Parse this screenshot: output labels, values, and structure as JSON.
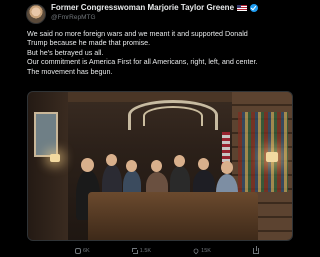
{
  "author": {
    "display_name": "Former Congresswoman Marjorie Taylor Greene",
    "handle": "@FmrRepMTG"
  },
  "icons": {
    "flag": "us-flag-icon",
    "verified": "verified-badge-icon",
    "reply": "reply-icon",
    "retweet": "retweet-icon",
    "like": "heart-icon",
    "share": "share-icon"
  },
  "tweet": {
    "lines": [
      "We said no more foreign wars and we meant it and supported Donald",
      "Trump because he made that promise.",
      "But he's betrayed us all.",
      "Our commitment is America First for all Americans, right, left, and center.",
      "The movement has begun."
    ]
  },
  "stats": {
    "replies": "6K",
    "retweets": "1.5K",
    "likes": "15K",
    "share": ""
  },
  "colors": {
    "background": "#000000",
    "text": "#e7e9ea",
    "secondary": "#71767b",
    "verified": "#1d9bf0"
  }
}
